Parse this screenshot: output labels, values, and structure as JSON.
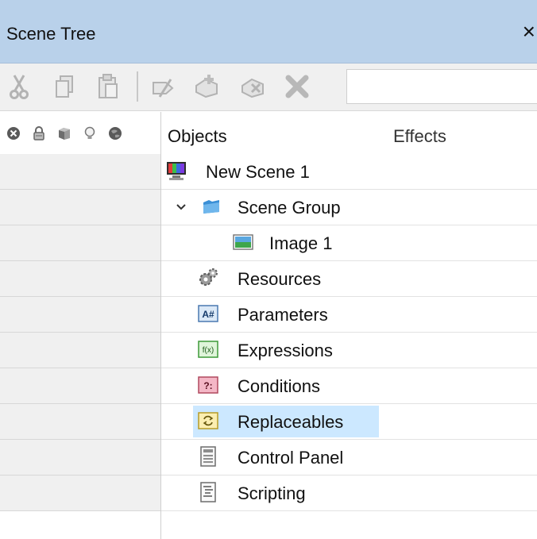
{
  "window": {
    "title": "Scene Tree",
    "close_glyph": "×"
  },
  "toolbar": {
    "buttons": [
      {
        "name": "cut-icon",
        "enabled": false
      },
      {
        "name": "copy-icon",
        "enabled": false
      },
      {
        "name": "paste-icon",
        "enabled": false
      },
      {
        "name": "rename-icon",
        "enabled": false
      },
      {
        "name": "add-object-icon",
        "enabled": false
      },
      {
        "name": "remove-object-icon",
        "enabled": false
      },
      {
        "name": "delete-icon",
        "enabled": false
      }
    ],
    "search_value": ""
  },
  "columns": {
    "header_icons": [
      "close-circle-icon",
      "lock-icon",
      "cube-icon",
      "lightbulb-icon",
      "globe-icon"
    ],
    "objects": "Objects",
    "effects": "Effects"
  },
  "tree": {
    "items": [
      {
        "label": "New Scene 1",
        "icon": "scene-monitor-icon"
      },
      {
        "label": "Scene Group",
        "icon": "folder-icon",
        "expanded": true
      },
      {
        "label": "Image 1",
        "icon": "image-icon"
      },
      {
        "label": "Resources",
        "icon": "gears-icon"
      },
      {
        "label": "Parameters",
        "icon": "parameters-a-hash-icon",
        "badge": "A#"
      },
      {
        "label": "Expressions",
        "icon": "function-fx-icon",
        "badge": "f(x)"
      },
      {
        "label": "Conditions",
        "icon": "conditions-icon",
        "badge": "?:"
      },
      {
        "label": "Replaceables",
        "icon": "replaceables-icon",
        "selected": true
      },
      {
        "label": "Control Panel",
        "icon": "control-panel-icon"
      },
      {
        "label": "Scripting",
        "icon": "scripting-icon"
      }
    ]
  }
}
